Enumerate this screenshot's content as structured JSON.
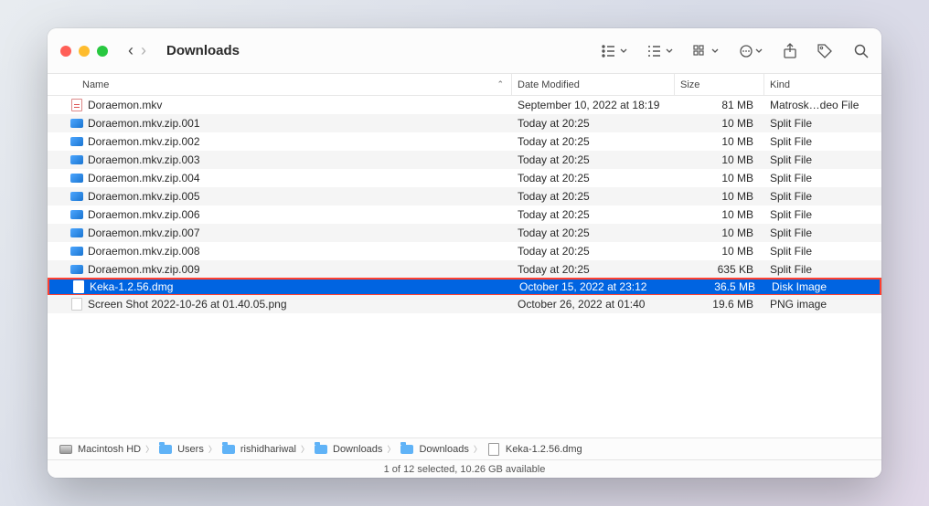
{
  "window": {
    "title": "Downloads"
  },
  "columns": {
    "name": "Name",
    "date": "Date Modified",
    "size": "Size",
    "kind": "Kind"
  },
  "files": [
    {
      "name": "Doraemon.mkv",
      "date": "September 10, 2022 at 18:19",
      "size": "81 MB",
      "kind": "Matrosk…deo File",
      "icon": "mkv",
      "selected": false,
      "highlighted": false
    },
    {
      "name": "Doraemon.mkv.zip.001",
      "date": "Today at 20:25",
      "size": "10 MB",
      "kind": "Split File",
      "icon": "split",
      "selected": false,
      "highlighted": false
    },
    {
      "name": "Doraemon.mkv.zip.002",
      "date": "Today at 20:25",
      "size": "10 MB",
      "kind": "Split File",
      "icon": "split",
      "selected": false,
      "highlighted": false
    },
    {
      "name": "Doraemon.mkv.zip.003",
      "date": "Today at 20:25",
      "size": "10 MB",
      "kind": "Split File",
      "icon": "split",
      "selected": false,
      "highlighted": false
    },
    {
      "name": "Doraemon.mkv.zip.004",
      "date": "Today at 20:25",
      "size": "10 MB",
      "kind": "Split File",
      "icon": "split",
      "selected": false,
      "highlighted": false
    },
    {
      "name": "Doraemon.mkv.zip.005",
      "date": "Today at 20:25",
      "size": "10 MB",
      "kind": "Split File",
      "icon": "split",
      "selected": false,
      "highlighted": false
    },
    {
      "name": "Doraemon.mkv.zip.006",
      "date": "Today at 20:25",
      "size": "10 MB",
      "kind": "Split File",
      "icon": "split",
      "selected": false,
      "highlighted": false
    },
    {
      "name": "Doraemon.mkv.zip.007",
      "date": "Today at 20:25",
      "size": "10 MB",
      "kind": "Split File",
      "icon": "split",
      "selected": false,
      "highlighted": false
    },
    {
      "name": "Doraemon.mkv.zip.008",
      "date": "Today at 20:25",
      "size": "10 MB",
      "kind": "Split File",
      "icon": "split",
      "selected": false,
      "highlighted": false
    },
    {
      "name": "Doraemon.mkv.zip.009",
      "date": "Today at 20:25",
      "size": "635 KB",
      "kind": "Split File",
      "icon": "split",
      "selected": false,
      "highlighted": false
    },
    {
      "name": "Keka-1.2.56.dmg",
      "date": "October 15, 2022 at 23:12",
      "size": "36.5 MB",
      "kind": "Disk Image",
      "icon": "dmg",
      "selected": true,
      "highlighted": true
    },
    {
      "name": "Screen Shot 2022-10-26 at 01.40.05.png",
      "date": "October 26, 2022 at 01:40",
      "size": "19.6 MB",
      "kind": "PNG image",
      "icon": "png",
      "selected": false,
      "highlighted": false
    }
  ],
  "path": [
    {
      "label": "Macintosh HD",
      "icon": "hd"
    },
    {
      "label": "Users",
      "icon": "folder"
    },
    {
      "label": "rishidhariwal",
      "icon": "folder"
    },
    {
      "label": "Downloads",
      "icon": "folder"
    },
    {
      "label": "Downloads",
      "icon": "folder"
    },
    {
      "label": "Keka-1.2.56.dmg",
      "icon": "dmg"
    }
  ],
  "status": "1 of 12 selected, 10.26 GB available"
}
